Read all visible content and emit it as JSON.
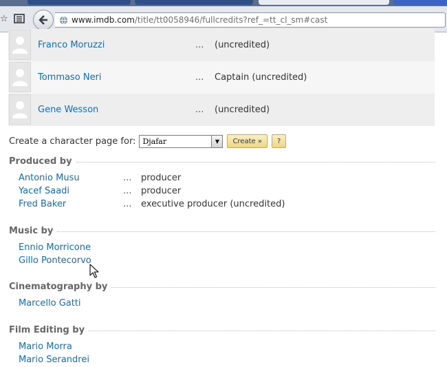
{
  "browser": {
    "url_host": "www.imdb.com",
    "url_path": "/title/tt0058946/fullcredits?ref_=tt_cl_sm#cast"
  },
  "cast": [
    {
      "name": "Franco Moruzzi",
      "dots": "...",
      "character": "(uncredited)"
    },
    {
      "name": "Tommaso Neri",
      "dots": "...",
      "character": "Captain (uncredited)"
    },
    {
      "name": "Gene Wesson",
      "dots": "...",
      "character": "(uncredited)"
    }
  ],
  "character_page": {
    "label": "Create a character page for:",
    "selected": "Djafar",
    "create_label": "Create »",
    "help_label": "?"
  },
  "produced_by": {
    "title": "Produced by",
    "rows": [
      {
        "name": "Antonio Musu",
        "dots": "...",
        "role": "producer"
      },
      {
        "name": "Yacef Saadi",
        "dots": "...",
        "role": "producer"
      },
      {
        "name": "Fred Baker",
        "dots": "...",
        "role": "executive producer (uncredited)"
      }
    ]
  },
  "music_by": {
    "title": "Music by",
    "rows": [
      {
        "name": "Ennio Morricone"
      },
      {
        "name": "Gillo Pontecorvo"
      }
    ]
  },
  "cinematography_by": {
    "title": "Cinematography by",
    "rows": [
      {
        "name": "Marcello Gatti"
      }
    ]
  },
  "film_editing_by": {
    "title": "Film Editing by",
    "rows": [
      {
        "name": "Mario Morra"
      },
      {
        "name": "Mario Serandrei"
      }
    ]
  },
  "colors": {
    "link": "#136cb2",
    "section_title": "#666666"
  }
}
